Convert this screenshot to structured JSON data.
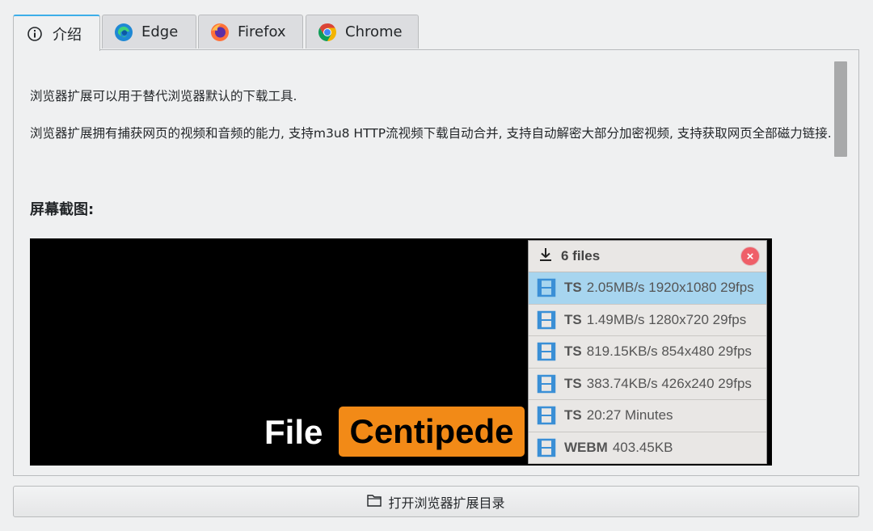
{
  "tabs": [
    {
      "label": "介绍",
      "icon": "info-icon"
    },
    {
      "label": "Edge",
      "icon": "edge-icon"
    },
    {
      "label": "Firefox",
      "icon": "firefox-icon"
    },
    {
      "label": "Chrome",
      "icon": "chrome-icon"
    }
  ],
  "active_tab": 0,
  "content": {
    "intro": "浏览器扩展可以用于替代浏览器默认的下载工具.",
    "description": " 浏览器扩展拥有捕获网页的视频和音频的能力, 支持m3u8 HTTP流视频下载自动合并, 支持自动解密大部分加密视频, 支持获取网页全部磁力链接.",
    "screenshot_title": "屏幕截图:"
  },
  "screenshot": {
    "logo_word1": "File",
    "logo_word2": "Centipede",
    "popup": {
      "title": "6 files",
      "close_symbol": "×",
      "items": [
        {
          "format": "TS",
          "detail": "2.05MB/s 1920x1080 29fps",
          "selected": true
        },
        {
          "format": "TS",
          "detail": "1.49MB/s 1280x720 29fps",
          "selected": false
        },
        {
          "format": "TS",
          "detail": "819.15KB/s 854x480 29fps",
          "selected": false
        },
        {
          "format": "TS",
          "detail": "383.74KB/s 426x240 29fps",
          "selected": false
        },
        {
          "format": "TS",
          "detail": "20:27 Minutes",
          "selected": false
        },
        {
          "format": "WEBM",
          "detail": "403.45KB",
          "selected": false
        }
      ]
    }
  },
  "open_button": {
    "label": "打开浏览器扩展目录",
    "icon": "folder-icon"
  },
  "colors": {
    "accent": "#3daee9",
    "brand_orange": "#f28a17",
    "selection": "#a7d5ef",
    "close_red": "#ef5f68"
  }
}
